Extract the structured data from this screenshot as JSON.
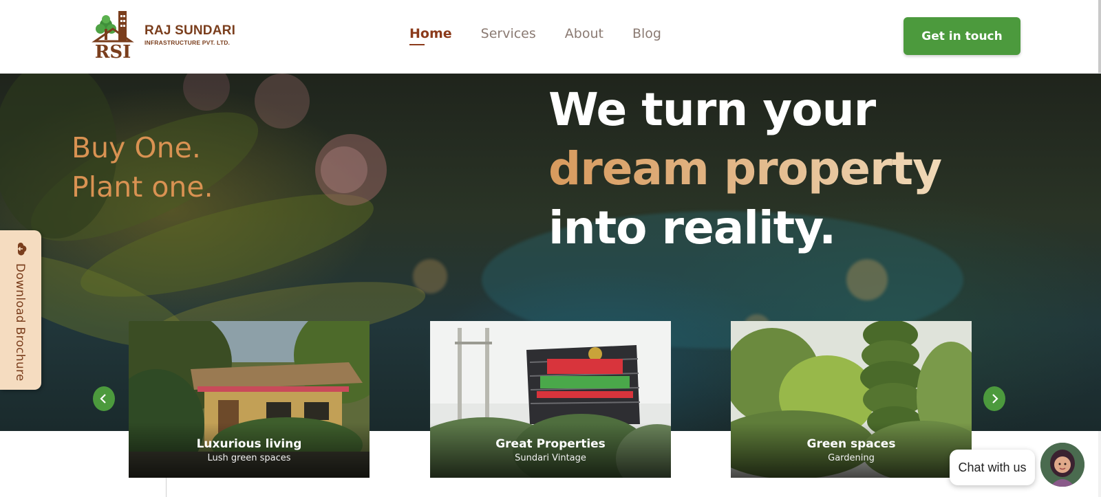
{
  "brand": {
    "name": "RAJ SUNDARI",
    "subtitle": "INFRASTRUCTURE PVT. LTD.",
    "mark_text": "RSI"
  },
  "nav": {
    "items": [
      {
        "label": "Home",
        "active": true
      },
      {
        "label": "Services",
        "active": false
      },
      {
        "label": "About",
        "active": false
      },
      {
        "label": "Blog",
        "active": false
      }
    ]
  },
  "header": {
    "cta_label": "Get in touch"
  },
  "hero": {
    "tagline_line1": "Buy One.",
    "tagline_line2": "Plant one.",
    "headline_line1": "We turn your",
    "headline_line2": "dream property",
    "headline_line3": "into reality."
  },
  "brochure": {
    "label": "Download Brochure",
    "icon": "cloud-download-icon"
  },
  "carousel": {
    "prev_icon": "chevron-left-icon",
    "next_icon": "chevron-right-icon",
    "cards": [
      {
        "title": "Luxurious living",
        "subtitle": "Lush green spaces"
      },
      {
        "title": "Great Properties",
        "subtitle": "Sundari Vintage"
      },
      {
        "title": "Green spaces",
        "subtitle": "Gardening"
      }
    ]
  },
  "chat": {
    "label": "Chat with us",
    "avatar": "support-avatar-icon"
  },
  "colors": {
    "brand_brown": "#7a3e1d",
    "accent_green": "#4c9a3d",
    "tagline_orange": "#d99252",
    "brochure_bg": "#f5dcc0"
  }
}
